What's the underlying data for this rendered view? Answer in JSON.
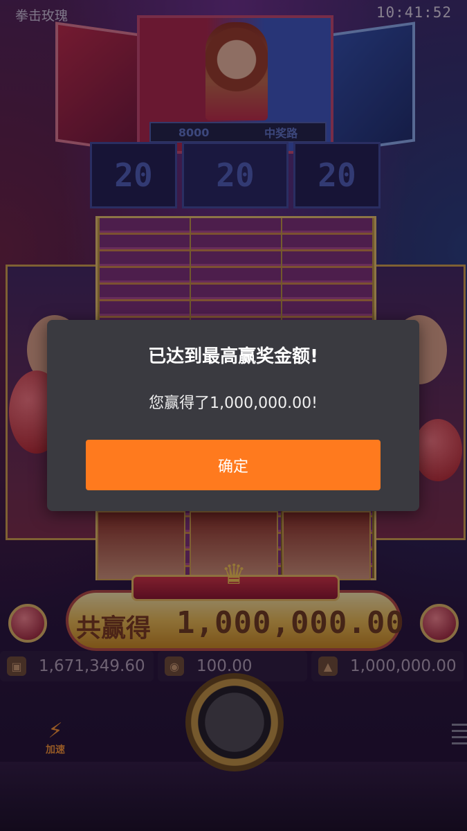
{
  "header": {
    "game_title": "拳击玫瑰",
    "clock": "10:41:52"
  },
  "scoreboard": {
    "left_number": "8000",
    "label": "中奖路",
    "counters": [
      "20",
      "20",
      "20"
    ]
  },
  "win_banner": {
    "label": "共赢得",
    "amount": "1,000,000.00"
  },
  "info_bar": {
    "balance": "1,671,349.60",
    "bet": "100.00",
    "win": "1,000,000.00"
  },
  "controls": {
    "turbo_label": "加速"
  },
  "dialog": {
    "title": "已达到最高赢奖金额!",
    "message": "您赢得了1,000,000.00!",
    "confirm_label": "确定"
  },
  "colors": {
    "confirm_button": "#ff7a1e",
    "dialog_bg": "#3a3a40"
  }
}
